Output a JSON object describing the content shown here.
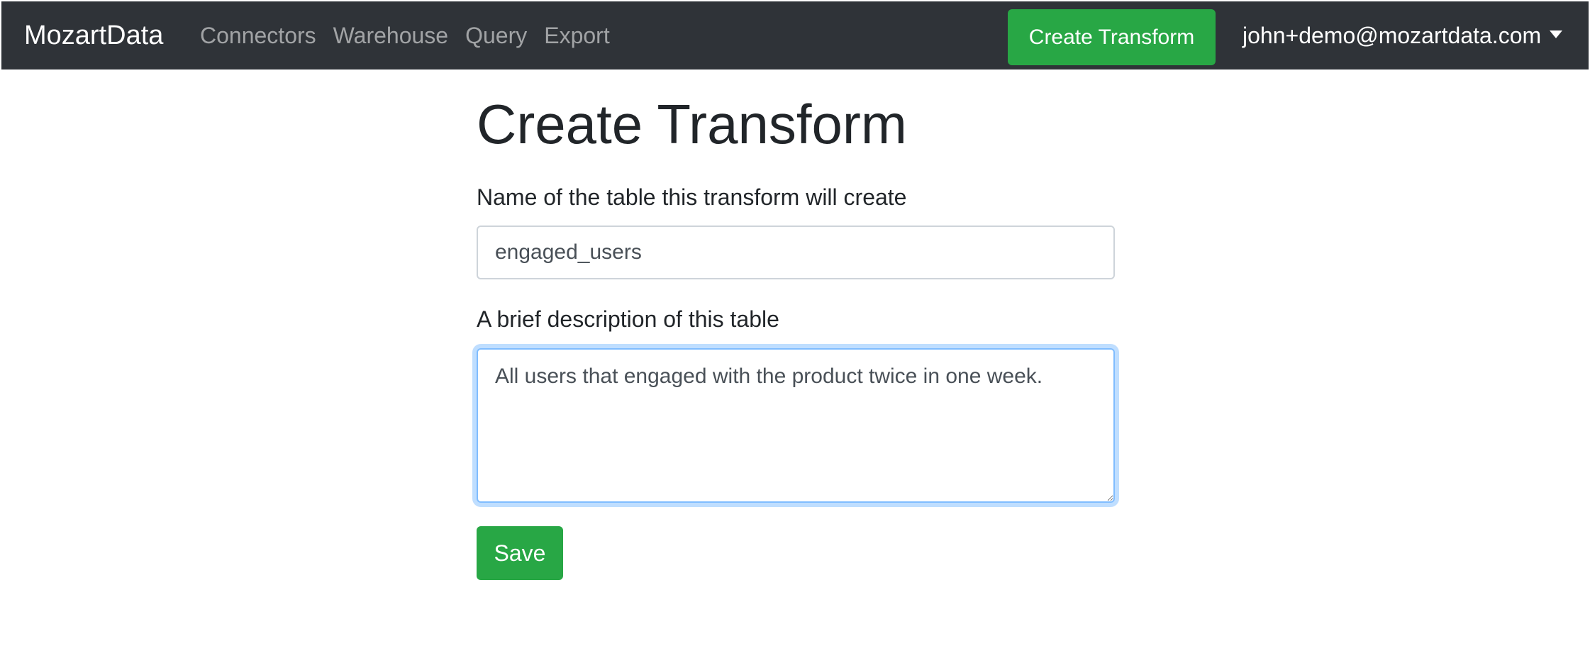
{
  "navbar": {
    "brand": "MozartData",
    "links": [
      "Connectors",
      "Warehouse",
      "Query",
      "Export"
    ],
    "cta_label": "Create Transform",
    "user_email": "john+demo@mozartdata.com",
    "bg_color": "#2f3338",
    "cta_color": "#28a745"
  },
  "main": {
    "title": "Create Transform",
    "name_field": {
      "label": "Name of the table this transform will create",
      "value": "engaged_users"
    },
    "description_field": {
      "label": "A brief description of this table",
      "value": "All users that engaged with the product twice in one week."
    },
    "save_label": "Save"
  },
  "icons": {
    "user_menu": "chevron-down-icon"
  }
}
